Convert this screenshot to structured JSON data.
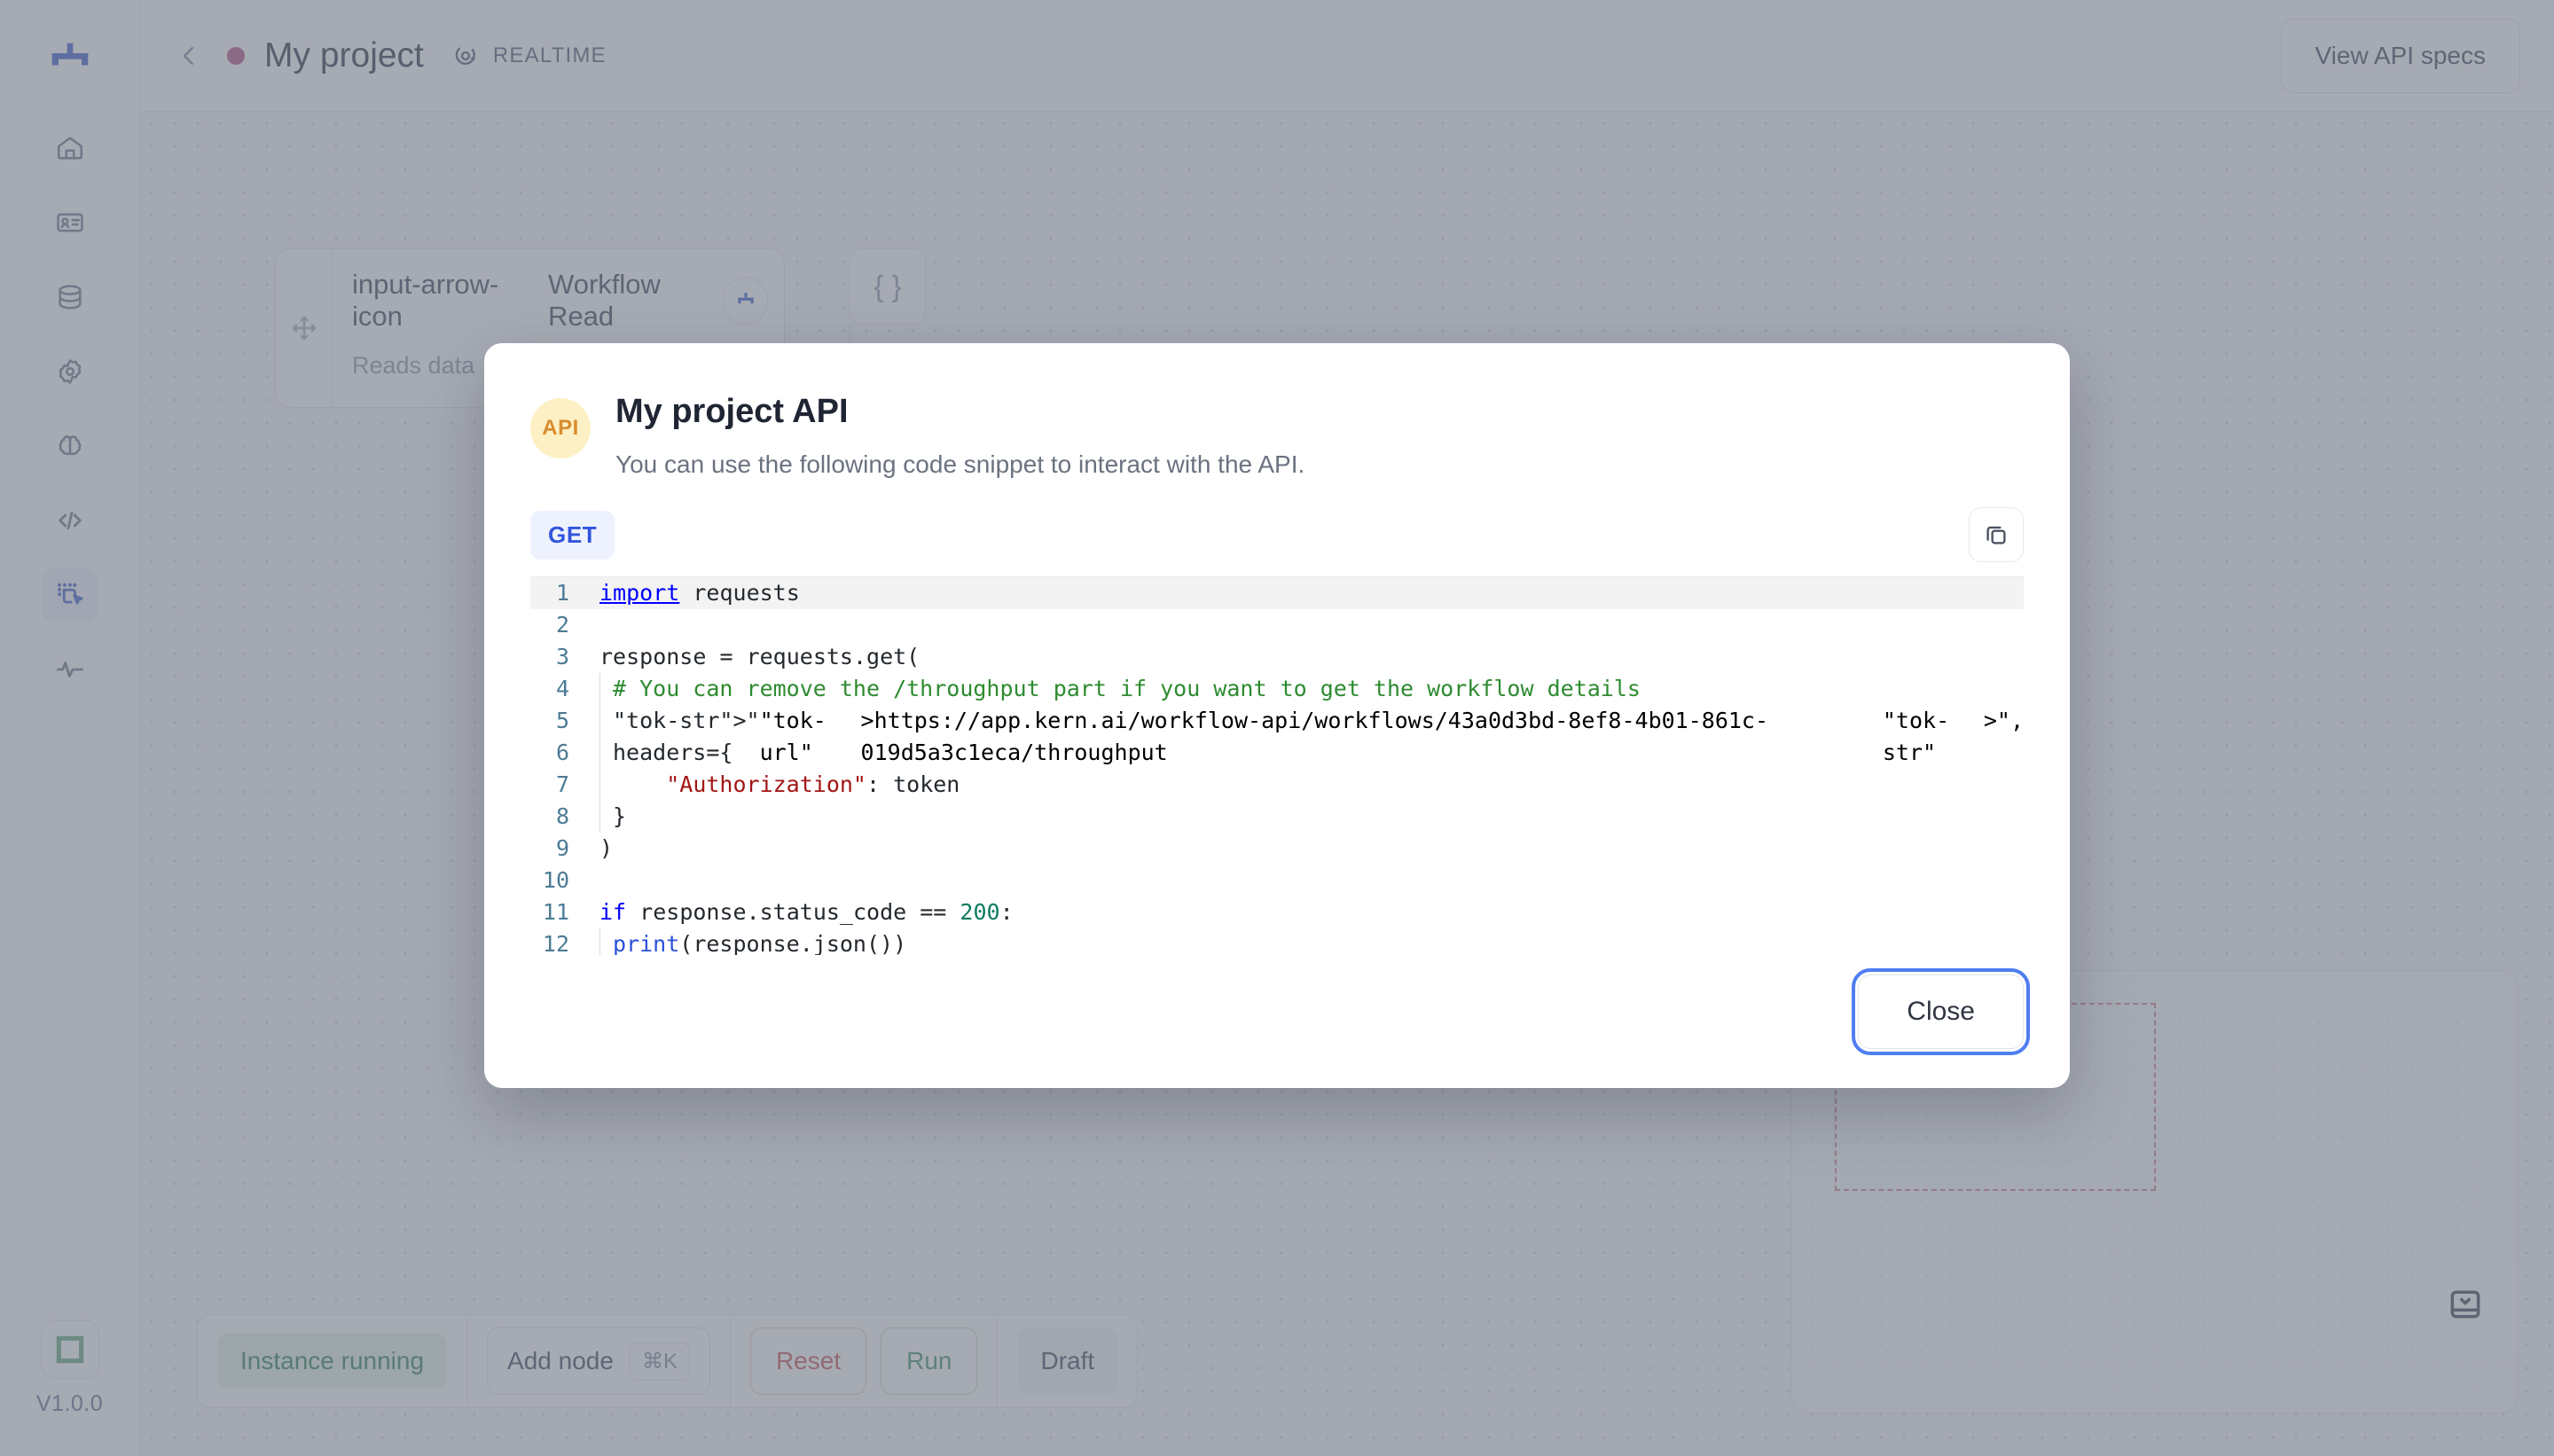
{
  "sidebar": {
    "logo_icon": "kern-logo-icon",
    "items": [
      {
        "icon": "home-icon",
        "name": "home",
        "active": false
      },
      {
        "icon": "id-card-icon",
        "name": "records",
        "active": false
      },
      {
        "icon": "database-icon",
        "name": "data",
        "active": false
      },
      {
        "icon": "gear-icon",
        "name": "settings",
        "active": false
      },
      {
        "icon": "brain-icon",
        "name": "models",
        "active": false
      },
      {
        "icon": "code-icon",
        "name": "code",
        "active": false
      },
      {
        "icon": "workflow-cursor-icon",
        "name": "workflows",
        "active": true
      },
      {
        "icon": "activity-icon",
        "name": "monitoring",
        "active": false
      }
    ],
    "env_icon": "environment-square-icon",
    "version": "V1.0.0"
  },
  "header": {
    "back_icon": "chevron-left-icon",
    "project_dot_color": "#bf5f8c",
    "project_title": "My project",
    "realtime_icon": "realtime-orbit-icon",
    "realtime_label": "REALTIME",
    "view_api_specs_label": "View API specs"
  },
  "canvas": {
    "node": {
      "drag_icon": "move-handle-icon",
      "arrow_icon": "input-arrow-icon",
      "title": "Workflow Read",
      "description": "Reads data",
      "badge_icon": "workflow-node-icon",
      "json_icon": "{ }"
    },
    "minimap": {
      "name": "minimap",
      "dots": 2
    },
    "collapse_icon": "collapse-panel-icon"
  },
  "bottom_bar": {
    "instance_status": "Instance running",
    "add_node_label": "Add node",
    "add_node_shortcut": "⌘K",
    "reset_label": "Reset",
    "run_label": "Run",
    "draft_label": "Draft"
  },
  "modal": {
    "avatar_text": "API",
    "title": "My project API",
    "subtitle": "You can use the following code snippet to interact with the API.",
    "method_badge": "GET",
    "copy_icon": "copy-icon",
    "close_label": "Close",
    "code": {
      "language": "python",
      "url": "https://app.kern.ai/workflow-api/workflows/43a0d3bd-8ef8-4b01-861c-019d5a3c1eca/throughput",
      "lines": [
        {
          "n": "1",
          "text": "import requests"
        },
        {
          "n": "2",
          "text": ""
        },
        {
          "n": "3",
          "text": "response = requests.get("
        },
        {
          "n": "4",
          "text": "    # You can remove the /throughput part if you want to get the workflow details"
        },
        {
          "n": "5",
          "text": "    \"https://app.kern.ai/workflow-api/workflows/43a0d3bd-8ef8-4b01-861c-019d5a3c1eca/throughput\","
        },
        {
          "n": "6",
          "text": "    headers={"
        },
        {
          "n": "7",
          "text": "        \"Authorization\": token"
        },
        {
          "n": "8",
          "text": "    }"
        },
        {
          "n": "9",
          "text": ")"
        },
        {
          "n": "10",
          "text": ""
        },
        {
          "n": "11",
          "text": "if response.status_code == 200:"
        },
        {
          "n": "12",
          "text": "    print(response.json())"
        }
      ]
    }
  },
  "colors": {
    "accent_blue": "#3355dd",
    "method_badge_bg": "#eef2fe",
    "avatar_bg": "#fdf0c4",
    "avatar_fg": "#d88c2e",
    "run_green": "#4f9a72",
    "reset_red": "#cc6060",
    "focus_ring": "#4f7df3"
  }
}
